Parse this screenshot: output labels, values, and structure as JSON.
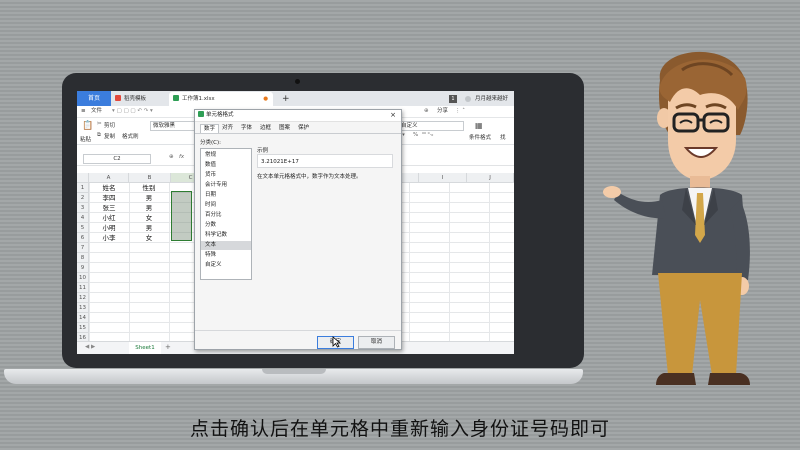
{
  "app": {
    "tabs": [
      {
        "label": "首页"
      },
      {
        "label": "稻壳模板"
      },
      {
        "label": "工作簿1.xlsx"
      }
    ],
    "add_tab": "+",
    "user_name": "月月越来越好",
    "badge": "1"
  },
  "menubar": {
    "file": "文件",
    "share": "分享"
  },
  "ribbon": {
    "cut": "剪切",
    "copy": "复制",
    "format_painter": "格式刷",
    "paste": "粘贴",
    "font": "微软雅黑",
    "number_format": "自定义",
    "conditional_format": "条件格式",
    "percent": "%",
    "find_label": "找"
  },
  "formula_bar": {
    "cell_ref": "C2",
    "fx": "fx"
  },
  "sheet": {
    "columns": [
      "A",
      "B",
      "C",
      "D",
      "E",
      "F",
      "G",
      "H",
      "I",
      "J"
    ],
    "rows": [
      "1",
      "2",
      "3",
      "4",
      "5",
      "6",
      "7",
      "8",
      "9",
      "10",
      "11",
      "12",
      "13",
      "14",
      "15",
      "16"
    ],
    "header": [
      "姓名",
      "性别"
    ],
    "data": [
      [
        "李四",
        "男"
      ],
      [
        "张三",
        "男"
      ],
      [
        "小红",
        "女"
      ],
      [
        "小明",
        "男"
      ],
      [
        "小李",
        "女"
      ]
    ],
    "sheet_tab": "Sheet1",
    "add_sheet": "+"
  },
  "dialog": {
    "title": "单元格格式",
    "close": "×",
    "tabs": [
      "数字",
      "对齐",
      "字体",
      "边框",
      "图案",
      "保护"
    ],
    "category_label": "分类(C):",
    "categories": [
      "常规",
      "数值",
      "货币",
      "会计专用",
      "日期",
      "时间",
      "百分比",
      "分数",
      "科学记数",
      "文本",
      "特殊",
      "自定义"
    ],
    "selected_category": "文本",
    "sample_label": "示例",
    "sample_value": "3.21021E+17",
    "description": "在文本单元格格式中，数字作为文本处理。",
    "ok": "确定",
    "cancel": "取消"
  },
  "subtitle": "点击确认后在单元格中重新输入身份证号码即可",
  "colors": {
    "wps_blue": "#3b7ddd",
    "selection_green": "#2e7d32",
    "suit": "#4a4f57",
    "pants": "#c8963c"
  }
}
